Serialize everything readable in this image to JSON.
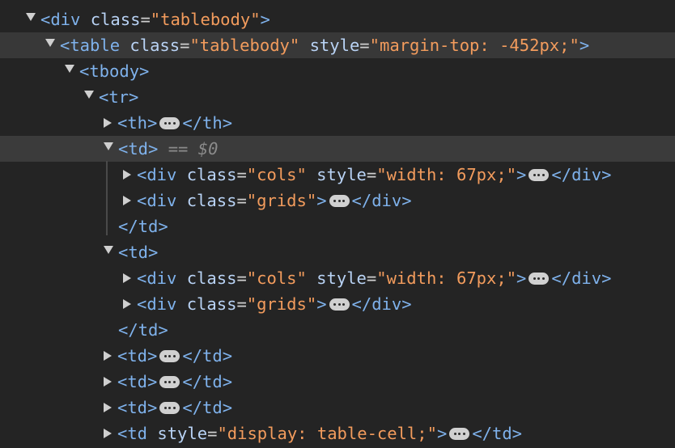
{
  "rows": [
    {
      "indent": 0,
      "toggle": "down",
      "hl": "",
      "parts": [
        [
          "tag",
          "<div "
        ],
        [
          "attr",
          "class"
        ],
        [
          "eq",
          "="
        ],
        [
          "val",
          "\"tablebody\""
        ],
        [
          "tag",
          ">"
        ]
      ]
    },
    {
      "indent": 1,
      "toggle": "down",
      "hl": "hl",
      "parts": [
        [
          "tag",
          "<table "
        ],
        [
          "attr",
          "class"
        ],
        [
          "eq",
          "="
        ],
        [
          "val",
          "\"tablebody\""
        ],
        [
          "attr",
          " style"
        ],
        [
          "eq",
          "="
        ],
        [
          "val",
          "\"margin-top: -452px;\""
        ],
        [
          "tag",
          ">"
        ]
      ]
    },
    {
      "indent": 2,
      "toggle": "down",
      "hl": "",
      "parts": [
        [
          "tag",
          "<tbody>"
        ]
      ]
    },
    {
      "indent": 3,
      "toggle": "down",
      "hl": "",
      "parts": [
        [
          "tag",
          "<tr>"
        ]
      ]
    },
    {
      "indent": 4,
      "toggle": "right",
      "hl": "",
      "parts": [
        [
          "tag",
          "<th>"
        ],
        [
          "ell",
          ""
        ],
        [
          "tag",
          "</th>"
        ]
      ]
    },
    {
      "indent": 4,
      "toggle": "down",
      "hl": "hl-sel",
      "parts": [
        [
          "tag",
          "<td>"
        ],
        [
          "sel",
          " == "
        ],
        [
          "selv",
          "$0"
        ]
      ]
    },
    {
      "indent": 5,
      "toggle": "right",
      "hl": "",
      "parts": [
        [
          "tag",
          "<div "
        ],
        [
          "attr",
          "class"
        ],
        [
          "eq",
          "="
        ],
        [
          "val",
          "\"cols\""
        ],
        [
          "attr",
          " style"
        ],
        [
          "eq",
          "="
        ],
        [
          "val",
          "\"width: 67px;\""
        ],
        [
          "tag",
          ">"
        ],
        [
          "ell",
          ""
        ],
        [
          "tag",
          "</div>"
        ]
      ]
    },
    {
      "indent": 5,
      "toggle": "right",
      "hl": "",
      "parts": [
        [
          "tag",
          "<div "
        ],
        [
          "attr",
          "class"
        ],
        [
          "eq",
          "="
        ],
        [
          "val",
          "\"grids\""
        ],
        [
          "tag",
          ">"
        ],
        [
          "ell",
          ""
        ],
        [
          "tag",
          "</div>"
        ]
      ]
    },
    {
      "indent": 4,
      "toggle": "none",
      "hl": "",
      "parts": [
        [
          "tag",
          "</td>"
        ]
      ]
    },
    {
      "indent": 4,
      "toggle": "down",
      "hl": "",
      "parts": [
        [
          "tag",
          "<td>"
        ]
      ]
    },
    {
      "indent": 5,
      "toggle": "right",
      "hl": "",
      "parts": [
        [
          "tag",
          "<div "
        ],
        [
          "attr",
          "class"
        ],
        [
          "eq",
          "="
        ],
        [
          "val",
          "\"cols\""
        ],
        [
          "attr",
          " style"
        ],
        [
          "eq",
          "="
        ],
        [
          "val",
          "\"width: 67px;\""
        ],
        [
          "tag",
          ">"
        ],
        [
          "ell",
          ""
        ],
        [
          "tag",
          "</div>"
        ]
      ]
    },
    {
      "indent": 5,
      "toggle": "right",
      "hl": "",
      "parts": [
        [
          "tag",
          "<div "
        ],
        [
          "attr",
          "class"
        ],
        [
          "eq",
          "="
        ],
        [
          "val",
          "\"grids\""
        ],
        [
          "tag",
          ">"
        ],
        [
          "ell",
          ""
        ],
        [
          "tag",
          "</div>"
        ]
      ]
    },
    {
      "indent": 4,
      "toggle": "none",
      "hl": "",
      "parts": [
        [
          "tag",
          "</td>"
        ]
      ]
    },
    {
      "indent": 4,
      "toggle": "right",
      "hl": "",
      "parts": [
        [
          "tag",
          "<td>"
        ],
        [
          "ell",
          ""
        ],
        [
          "tag",
          "</td>"
        ]
      ]
    },
    {
      "indent": 4,
      "toggle": "right",
      "hl": "",
      "parts": [
        [
          "tag",
          "<td>"
        ],
        [
          "ell",
          ""
        ],
        [
          "tag",
          "</td>"
        ]
      ]
    },
    {
      "indent": 4,
      "toggle": "right",
      "hl": "",
      "parts": [
        [
          "tag",
          "<td>"
        ],
        [
          "ell",
          ""
        ],
        [
          "tag",
          "</td>"
        ]
      ]
    },
    {
      "indent": 4,
      "toggle": "right",
      "hl": "",
      "parts": [
        [
          "tag",
          "<td "
        ],
        [
          "attr",
          "style"
        ],
        [
          "eq",
          "="
        ],
        [
          "val",
          "\"display: table-cell;\""
        ],
        [
          "tag",
          ">"
        ],
        [
          "ell",
          ""
        ],
        [
          "tag",
          "</td>"
        ]
      ]
    }
  ],
  "colors": {
    "tag": "#7fb2ec",
    "attribute": "#b9d3f5",
    "value": "#f39c5d",
    "background": "#242424"
  },
  "icons": {
    "expand": "triangle-down-icon",
    "collapse": "triangle-right-icon",
    "ellipsis": "ellipsis-icon"
  }
}
